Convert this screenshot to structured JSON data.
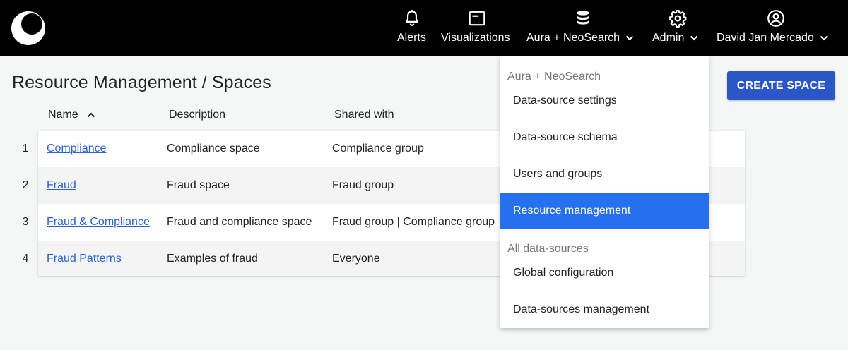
{
  "nav": {
    "items": [
      {
        "label": "Alerts",
        "icon": "bell-icon"
      },
      {
        "label": "Visualizations",
        "icon": "window-icon"
      },
      {
        "label": "Aura + NeoSearch",
        "icon": "database-icon"
      },
      {
        "label": "Admin",
        "icon": "gear-icon"
      },
      {
        "label": "David Jan Mercado",
        "icon": "user-circle-icon"
      }
    ]
  },
  "page": {
    "title": "Resource Management / Spaces",
    "create_label": "CREATE SPACE"
  },
  "table": {
    "columns": [
      "Name",
      "Description",
      "Shared with"
    ],
    "rows": [
      {
        "num": "1",
        "name": "Compliance",
        "description": "Compliance space",
        "shared": "Compliance group"
      },
      {
        "num": "2",
        "name": "Fraud",
        "description": "Fraud space",
        "shared": "Fraud group"
      },
      {
        "num": "3",
        "name": "Fraud & Compliance",
        "description": "Fraud and compliance space",
        "shared": "Fraud group | Compliance group"
      },
      {
        "num": "4",
        "name": "Fraud Patterns",
        "description": "Examples of fraud",
        "shared": "Everyone"
      }
    ]
  },
  "dropdown": {
    "section1": "Aura + NeoSearch",
    "items1": [
      "Data-source settings",
      "Data-source schema",
      "Users and groups",
      "Resource management"
    ],
    "section2": "All data-sources",
    "items2": [
      "Global configuration",
      "Data-sources management"
    ]
  },
  "colors": {
    "topbar": "#000000",
    "primary_button": "#2a57c5",
    "active_menu": "#2670ee",
    "link": "#2a62cf"
  }
}
